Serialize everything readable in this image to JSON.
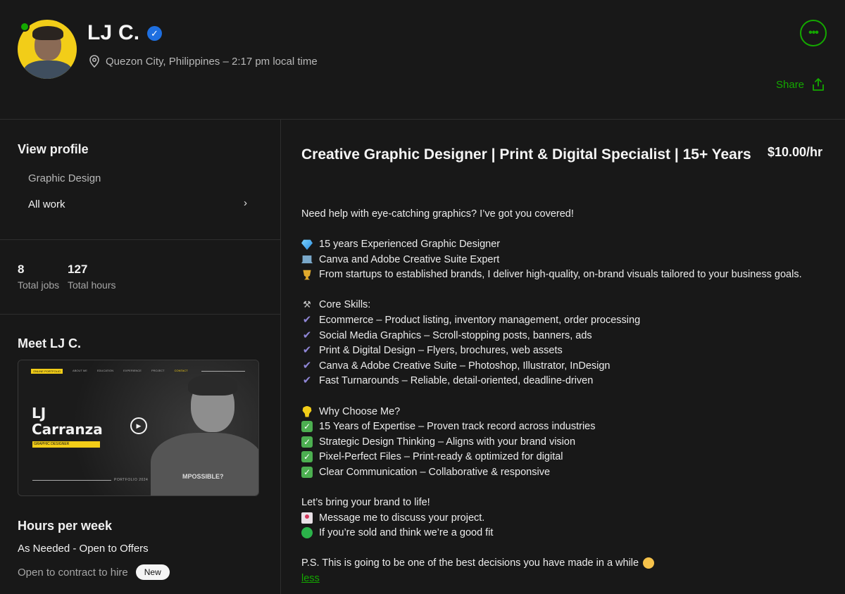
{
  "profile": {
    "name": "LJ C.",
    "location": "Quezon City, Philippines – 2:17 pm local time",
    "more_label": "•••",
    "share_label": "Share"
  },
  "sidebar": {
    "view_profile_title": "View profile",
    "items": [
      {
        "label": "Graphic Design"
      },
      {
        "label": "All work"
      }
    ],
    "chevron": "›",
    "stats": [
      {
        "value": "8",
        "label": "Total jobs"
      },
      {
        "value": "127",
        "label": "Total hours"
      }
    ],
    "meet_title": "Meet LJ C.",
    "video": {
      "nav": [
        "ONLINE PORTFOLIO",
        "ABOUT ME",
        "EDUCATION",
        "EXPERIENCE",
        "PROJECT",
        "CONTACT"
      ],
      "name_line1": "LJ",
      "name_line2": "Carranza",
      "role": "GRAPHIC DESIGNER",
      "folio": "PORTFOLIO 2024",
      "shirt": "MPOSSIBLE?"
    },
    "hours_title": "Hours per week",
    "hours_value": "As Needed - Open to Offers",
    "contract_text": "Open to contract to hire",
    "new_badge": "New"
  },
  "main": {
    "headline": "Creative Graphic Designer | Print & Digital Specialist | 15+ Years",
    "rate": "$10.00/hr",
    "intro": "Need help with eye-catching graphics? I’ve got you covered!",
    "highlights": [
      {
        "icon": "gem-icon",
        "text": "15 years Experienced Graphic Designer"
      },
      {
        "icon": "laptop-icon",
        "text": "Canva and Adobe Creative Suite Expert"
      },
      {
        "icon": "trophy-icon",
        "text": "From startups to established brands, I deliver high-quality, on-brand visuals tailored to your business goals."
      }
    ],
    "core_skills_title": "Core Skills:",
    "core_skills": [
      "Ecommerce – Product listing, inventory management, order processing",
      "Social Media Graphics – Scroll-stopping posts, banners, ads",
      "Print & Digital Design – Flyers, brochures, web assets",
      "Canva & Adobe Creative Suite – Photoshop, Illustrator, InDesign",
      "Fast Turnarounds – Reliable, detail-oriented, deadline-driven"
    ],
    "why_title": "Why Choose Me?",
    "why_items": [
      "15 Years of Expertise – Proven track record across industries",
      "Strategic Design Thinking – Aligns with your brand vision",
      "Pixel-Perfect Files – Print-ready & optimized for digital",
      "Clear Communication – Collaborative & responsive"
    ],
    "cta_line": "Let’s bring your brand to life!",
    "cta_message": "Message me to discuss your project.",
    "cta_fit": "If you’re sold and think we’re a good fit",
    "ps": "P.S. This is going to be one of the best decisions you have made in a while",
    "less_label": "less"
  },
  "colors": {
    "accent": "#14a800",
    "background": "#181818",
    "verified": "#1e6fe0",
    "avatar_bg": "#f2cd18"
  }
}
